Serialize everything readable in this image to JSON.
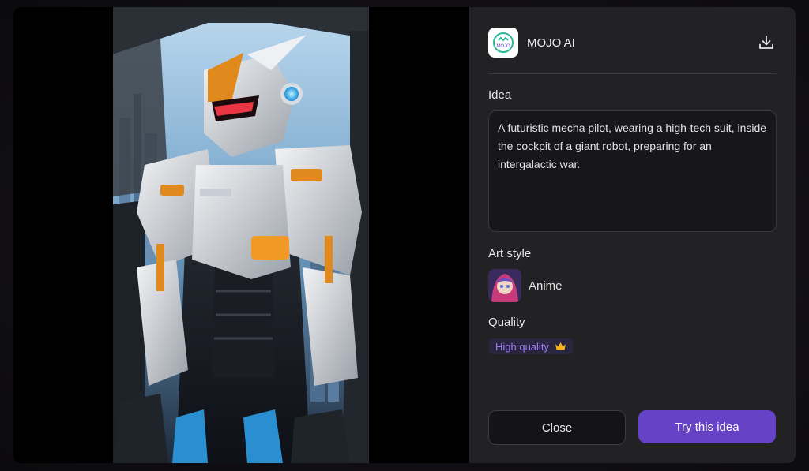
{
  "app": {
    "name": "MOJO AI",
    "logo_text": "MOJO"
  },
  "sections": {
    "idea_label": "Idea",
    "art_style_label": "Art style",
    "quality_label": "Quality"
  },
  "idea": {
    "text": "A futuristic mecha pilot, wearing a high-tech suit, inside the cockpit of a giant robot, preparing for an intergalactic war."
  },
  "art_style": {
    "name": "Anime"
  },
  "quality": {
    "value": "High quality"
  },
  "actions": {
    "close_label": "Close",
    "try_label": "Try this idea"
  },
  "icons": {
    "download": "download-icon",
    "crown": "crown-icon"
  },
  "colors": {
    "accent": "#6542c6",
    "badge_text": "#9b7cf5",
    "panel": "#222224"
  }
}
